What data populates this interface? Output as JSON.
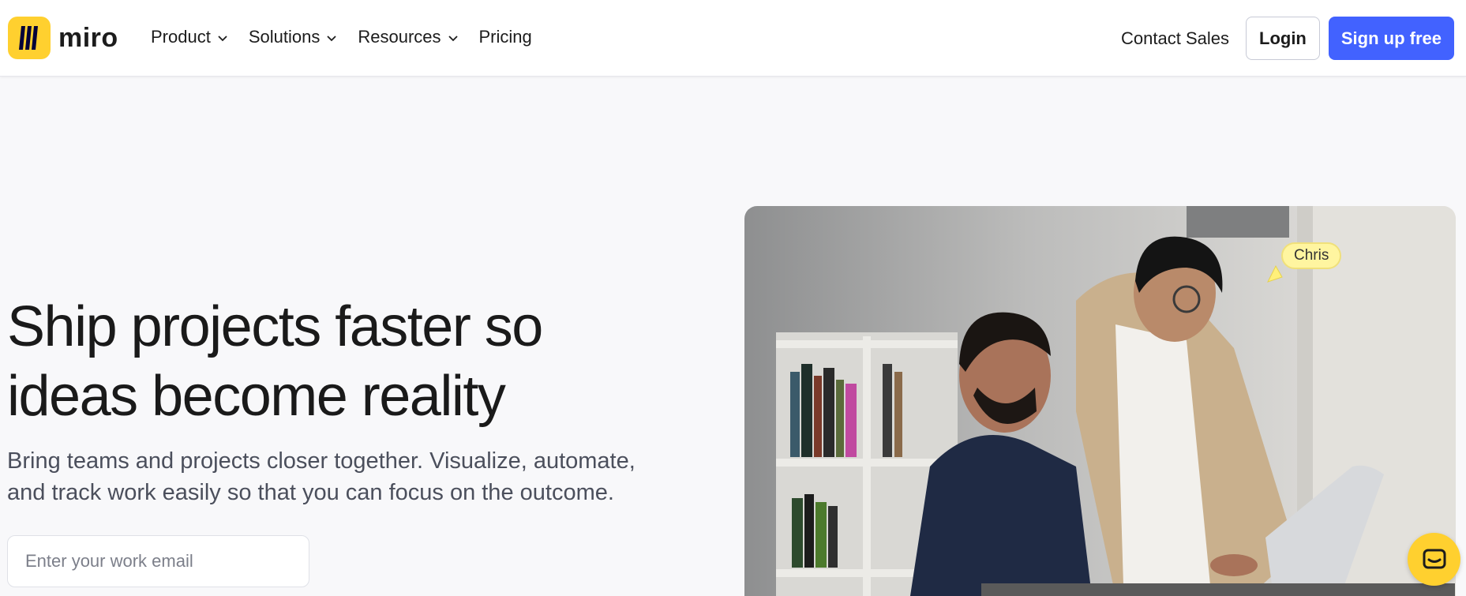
{
  "brand": {
    "name": "miro",
    "logo_color": "#ffd02f"
  },
  "nav": {
    "items": [
      {
        "label": "Product",
        "has_dropdown": true
      },
      {
        "label": "Solutions",
        "has_dropdown": true
      },
      {
        "label": "Resources",
        "has_dropdown": true
      },
      {
        "label": "Pricing",
        "has_dropdown": false
      }
    ],
    "contact_label": "Contact Sales",
    "login_label": "Login",
    "signup_label": "Sign up free",
    "signup_color": "#4262ff"
  },
  "hero": {
    "title_line1": "Ship projects faster so",
    "title_line2": "ideas become reality",
    "subtitle_line1": "Bring teams and projects closer together. Visualize, automate,",
    "subtitle_line2": "and track work easily so that you can focus on the outcome.",
    "email_placeholder": "Enter your work email",
    "email_value": ""
  },
  "image": {
    "cursor_name": "Chris"
  },
  "icons": {
    "dropdown": "chevron-down-icon",
    "chat": "chat-icon",
    "cursor": "cursor-arrow-icon"
  }
}
